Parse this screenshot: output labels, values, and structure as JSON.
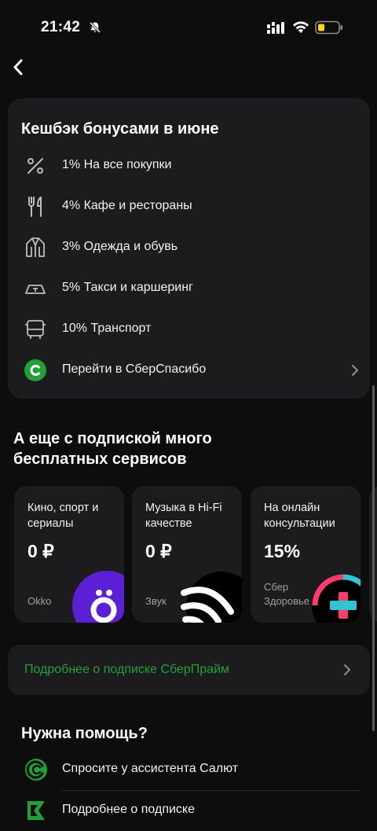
{
  "status_bar": {
    "time": "21:42"
  },
  "cashback": {
    "title": "Кешбэк бонусами в июне",
    "items": [
      {
        "label": "1% На все покупки",
        "icon": "percent-icon"
      },
      {
        "label": "4% Кафе и рестораны",
        "icon": "fork-knife-icon"
      },
      {
        "label": "3% Одежда и обувь",
        "icon": "coat-icon"
      },
      {
        "label": "5% Такси и каршеринг",
        "icon": "taxi-icon"
      },
      {
        "label": "10% Транспорт",
        "icon": "bus-icon"
      }
    ],
    "link_label": "Перейти в СберСпасибо"
  },
  "subscription": {
    "heading": "А еще с подпиской много бесплатных сервисов",
    "services": [
      {
        "label": "Кино, спорт и сериалы",
        "value": "0 ₽",
        "brand": "Okko"
      },
      {
        "label": "Музыка в Hi-Fi качестве",
        "value": "0 ₽",
        "brand": "Звук"
      },
      {
        "label": "На онлайн консультации",
        "value": "15%",
        "brand": "Сбер Здоровье"
      }
    ],
    "more_link": "Подробнее о подписке СберПрайм"
  },
  "help": {
    "title": "Нужна помощь?",
    "items": [
      {
        "label": "Спросите у ассистента Салют"
      },
      {
        "label": "Подробнее о подписке"
      }
    ]
  },
  "colors": {
    "background": "#0d0d0d",
    "card": "#1c1c1e",
    "accent_green": "#21a038",
    "okko_purple": "#5b1fd6"
  }
}
